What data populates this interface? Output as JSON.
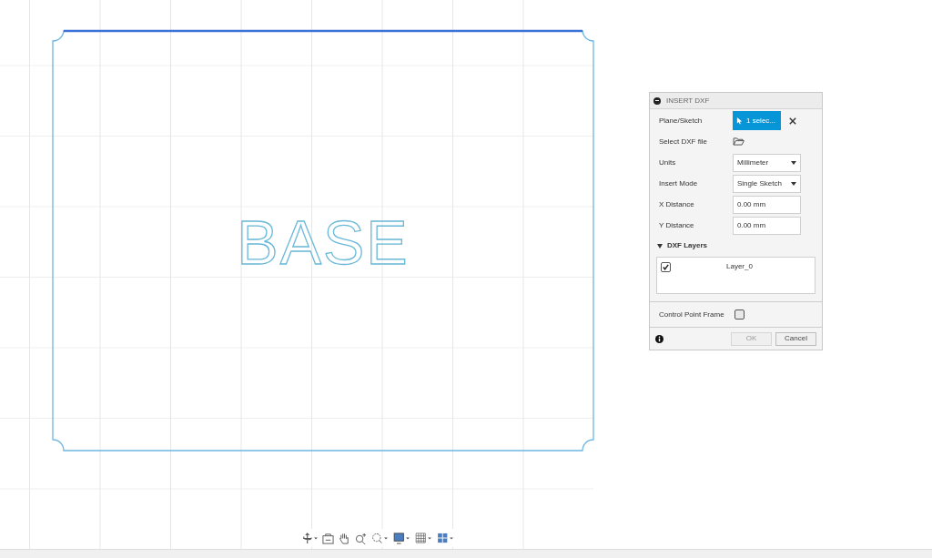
{
  "sketch": {
    "text": "BASE"
  },
  "dialog": {
    "title": "INSERT DXF",
    "rows": [
      {
        "kind": "selection",
        "label": "Plane/Sketch",
        "value": "1 selec..."
      },
      {
        "kind": "file",
        "label": "Select DXF file"
      },
      {
        "kind": "dropdown",
        "label": "Units",
        "value": "Millimeter"
      },
      {
        "kind": "dropdown",
        "label": "Insert Mode",
        "value": "Single Sketch"
      },
      {
        "kind": "input",
        "label": "X Distance",
        "value": "0.00 mm"
      },
      {
        "kind": "input",
        "label": "Y Distance",
        "value": "0.00 mm"
      }
    ],
    "layers_section": {
      "title": "DXF Layers",
      "expanded": true,
      "layers": [
        {
          "name": "Layer_0",
          "checked": true
        }
      ]
    },
    "control_point_frame": {
      "label": "Control Point Frame",
      "checked": false
    },
    "buttons": [
      {
        "label": "OK",
        "disabled": true
      },
      {
        "label": "Cancel",
        "disabled": false
      }
    ]
  }
}
